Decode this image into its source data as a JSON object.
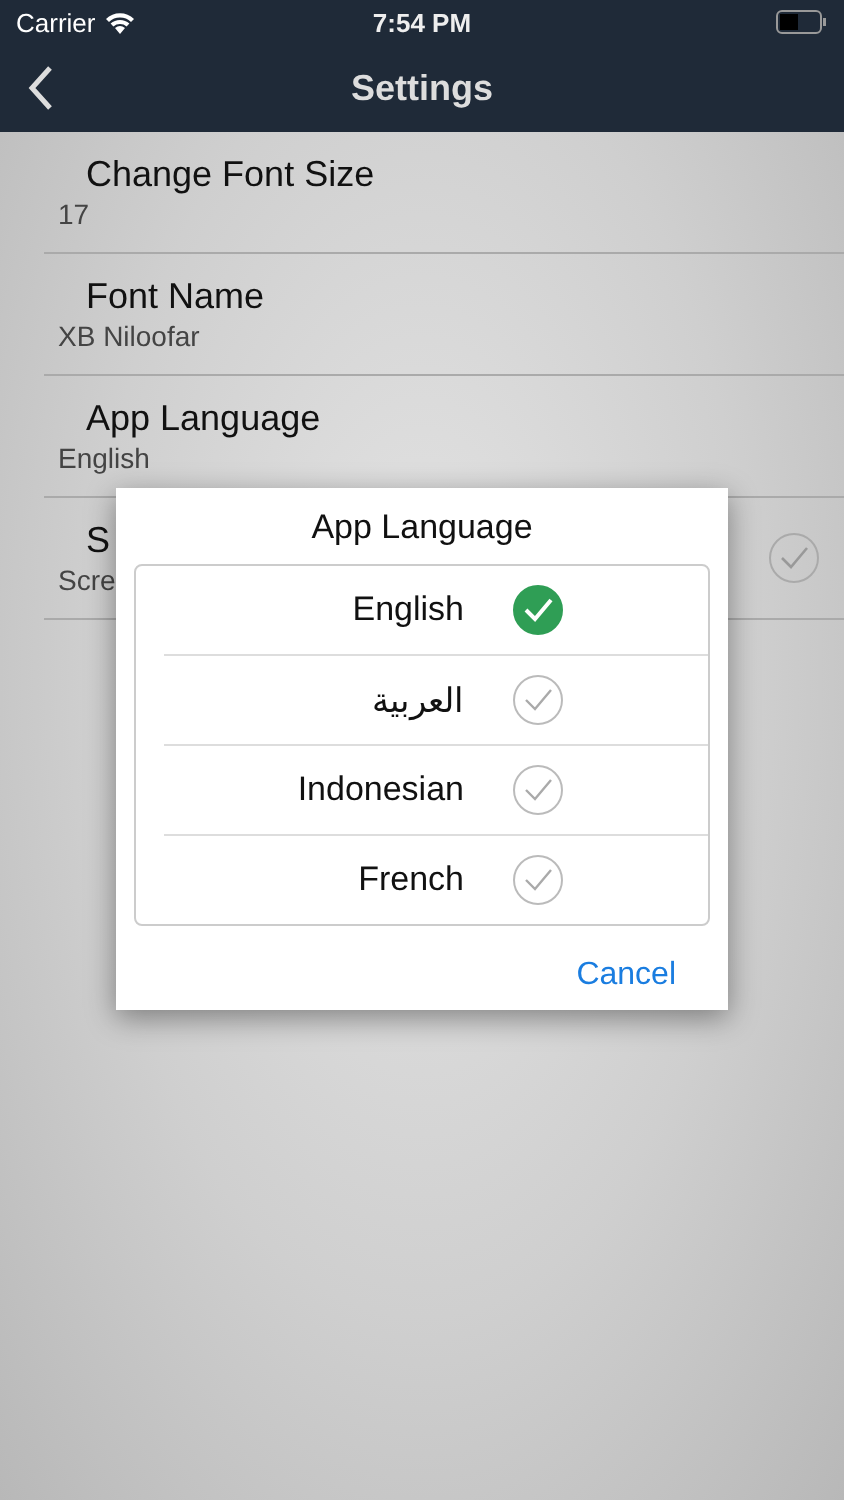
{
  "status_bar": {
    "carrier": "Carrier",
    "time": "7:54 PM"
  },
  "nav": {
    "title": "Settings"
  },
  "settings": [
    {
      "title": "Change Font Size",
      "value": "17",
      "kind": "plain"
    },
    {
      "title": "Font Name",
      "value": "XB Niloofar",
      "kind": "plain"
    },
    {
      "title": "App Language",
      "value": "English",
      "kind": "plain"
    },
    {
      "title": "S",
      "value": "Scre",
      "kind": "toggle",
      "checked": false
    }
  ],
  "dialog": {
    "title": "App Language",
    "options": [
      {
        "label": "English",
        "selected": true
      },
      {
        "label": "العربية",
        "selected": false
      },
      {
        "label": "Indonesian",
        "selected": false
      },
      {
        "label": "French",
        "selected": false
      }
    ],
    "cancel": "Cancel"
  }
}
